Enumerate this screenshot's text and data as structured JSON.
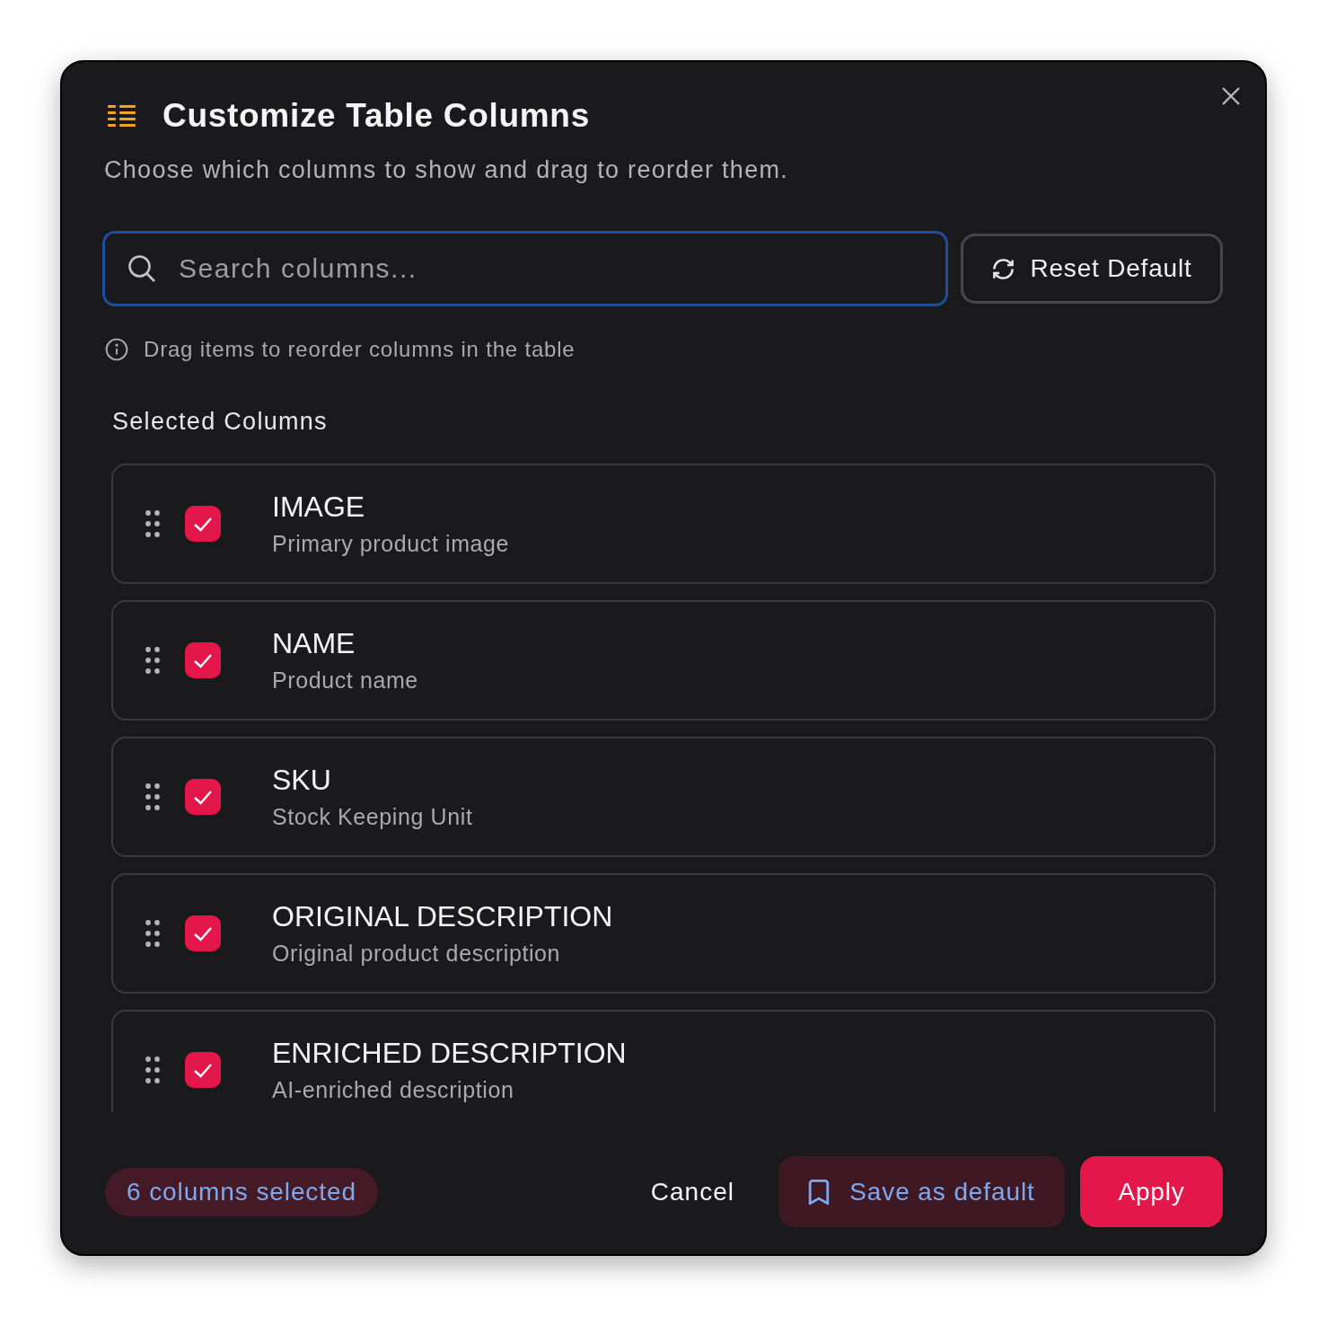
{
  "header": {
    "title": "Customize Table Columns",
    "subtitle": "Choose which columns to show and drag to reorder them."
  },
  "search": {
    "placeholder": "Search columns...",
    "focused": true
  },
  "reset_button": {
    "label": "Reset Default"
  },
  "hint": "Drag items to reorder columns in the table",
  "selected_columns": {
    "title": "Selected Columns",
    "items": [
      {
        "name": "IMAGE",
        "description": "Primary product image",
        "checked": true
      },
      {
        "name": "NAME",
        "description": "Product name",
        "checked": true
      },
      {
        "name": "SKU",
        "description": "Stock Keeping Unit",
        "checked": true
      },
      {
        "name": "ORIGINAL DESCRIPTION",
        "description": "Original product description",
        "checked": true
      },
      {
        "name": "ENRICHED DESCRIPTION",
        "description": "AI-enriched description",
        "checked": true
      }
    ]
  },
  "footer": {
    "selected_count": "6 columns selected",
    "cancel": "Cancel",
    "save_default": "Save as default",
    "apply": "Apply"
  }
}
